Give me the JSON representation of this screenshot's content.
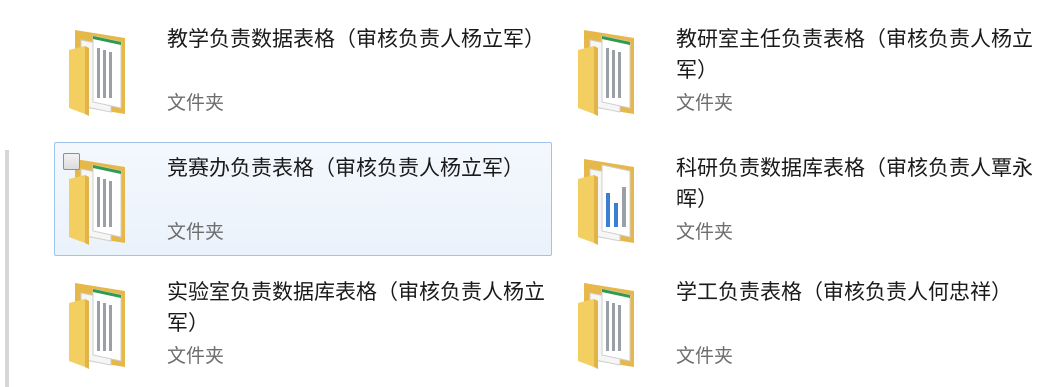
{
  "items": [
    {
      "name": "教学负责数据表格（审核负责人杨立军）",
      "type": "文件夹"
    },
    {
      "name": "教研室主任负责表格（审核负责人杨立军）",
      "type": "文件夹"
    },
    {
      "name": "竞赛办负责表格（审核负责人杨立军）",
      "type": "文件夹"
    },
    {
      "name": "科研负责数据库表格（审核负责人覃永晖）",
      "type": "文件夹"
    },
    {
      "name": "实验室负责数据库表格（审核负责人杨立军）",
      "type": "文件夹"
    },
    {
      "name": "学工负责表格（审核负责人何忠祥）",
      "type": "文件夹"
    }
  ],
  "colors": {
    "folder_front": "#f3cf62",
    "folder_back": "#e6b84a",
    "selection_border": "#9fc3ea",
    "stripe_green": "#2f9a52",
    "stripe_blue": "#3b7fd0"
  },
  "icons": {
    "folder": "folder-icon",
    "checkbox": "checkbox-icon"
  }
}
